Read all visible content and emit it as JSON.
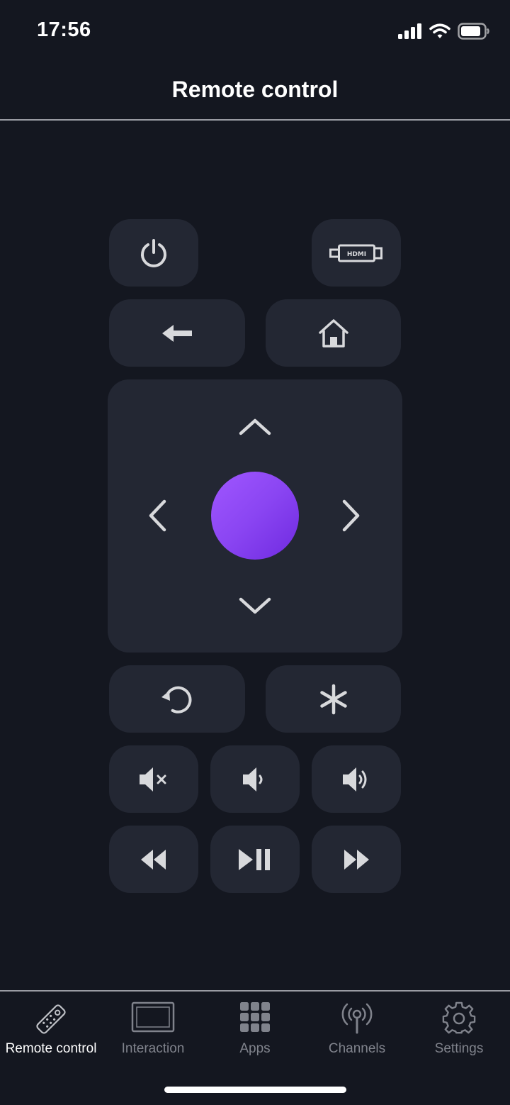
{
  "status_bar": {
    "time": "17:56"
  },
  "header": {
    "title": "Remote control"
  },
  "remote": {
    "buttons": {
      "power": "power-icon",
      "input": "hdmi-icon",
      "back": "back-arrow-icon",
      "home": "home-icon",
      "replay": "replay-icon",
      "options": "asterisk-icon",
      "mute": "volume-mute-icon",
      "volume_down": "volume-down-icon",
      "volume_up": "volume-up-icon",
      "rewind": "rewind-icon",
      "play_pause": "play-pause-icon",
      "fast_forward": "fast-forward-icon"
    },
    "ok_button_gradient": [
      "#a057ff",
      "#6f2ae0"
    ]
  },
  "tabs": [
    {
      "label": "Remote control",
      "icon": "remote-icon",
      "active": true
    },
    {
      "label": "Interaction",
      "icon": "screen-icon",
      "active": false
    },
    {
      "label": "Apps",
      "icon": "grid-icon",
      "active": false
    },
    {
      "label": "Channels",
      "icon": "broadcast-icon",
      "active": false
    },
    {
      "label": "Settings",
      "icon": "gear-icon",
      "active": false
    }
  ],
  "colors": {
    "background": "#141720",
    "button": "#232733",
    "icon": "#d8d9dc",
    "tab_inactive": "#80838c",
    "tab_active": "#ffffff"
  }
}
